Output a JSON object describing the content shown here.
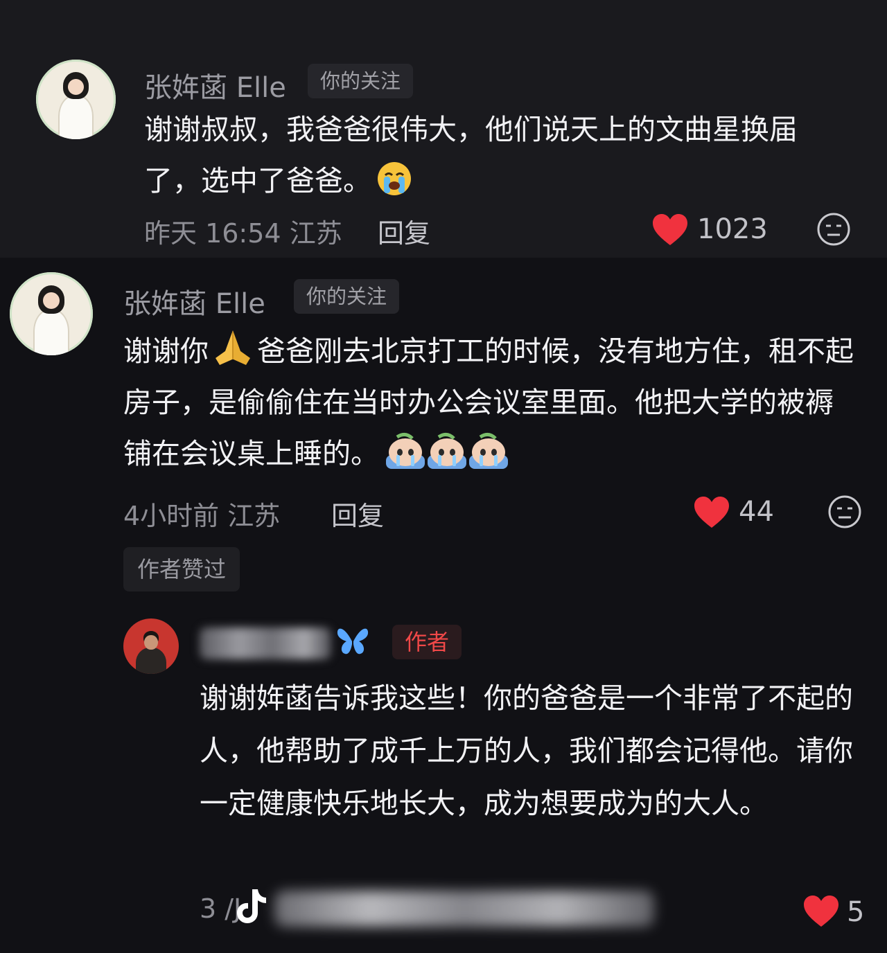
{
  "comments": [
    {
      "author": "张姩菡 Elle",
      "tag": "你的关注",
      "text": "谢谢叔叔，我爸爸很伟大，他们说天上的文曲星换届了，选中了爸爸。",
      "emoji": "loudly-crying-face",
      "time": "昨天 16:54",
      "location": "江苏",
      "reply_label": "回复",
      "likes": "1023"
    },
    {
      "author": "张姩菡 Elle",
      "tag": "你的关注",
      "text_part1": "谢谢你",
      "text_part2": "爸爸刚去北京打工的时候，没有地方住，租不起房子，是偷偷住在当时办公会议室里面。他把大学的被褥铺在会议桌上睡的。",
      "emoji_inline": "folded-hands",
      "emoji_trailing": [
        "crying-bun",
        "crying-bun",
        "crying-bun"
      ],
      "time": "4小时前",
      "location": "江苏",
      "reply_label": "回复",
      "likes": "44",
      "liked_badge": "作者赞过"
    },
    {
      "author_tag": "作者",
      "text": "谢谢姩菡告诉我这些！你的爸爸是一个非常了不起的人，他帮助了成千上万的人，我们都会记得他。请你一定健康快乐地长大，成为想要成为的大人。",
      "time_partial": "3 /J",
      "likes": "5"
    }
  ],
  "colors": {
    "heart": "#f0323e",
    "author_tag": "#f04848",
    "butterfly": "#5aa8ff"
  }
}
